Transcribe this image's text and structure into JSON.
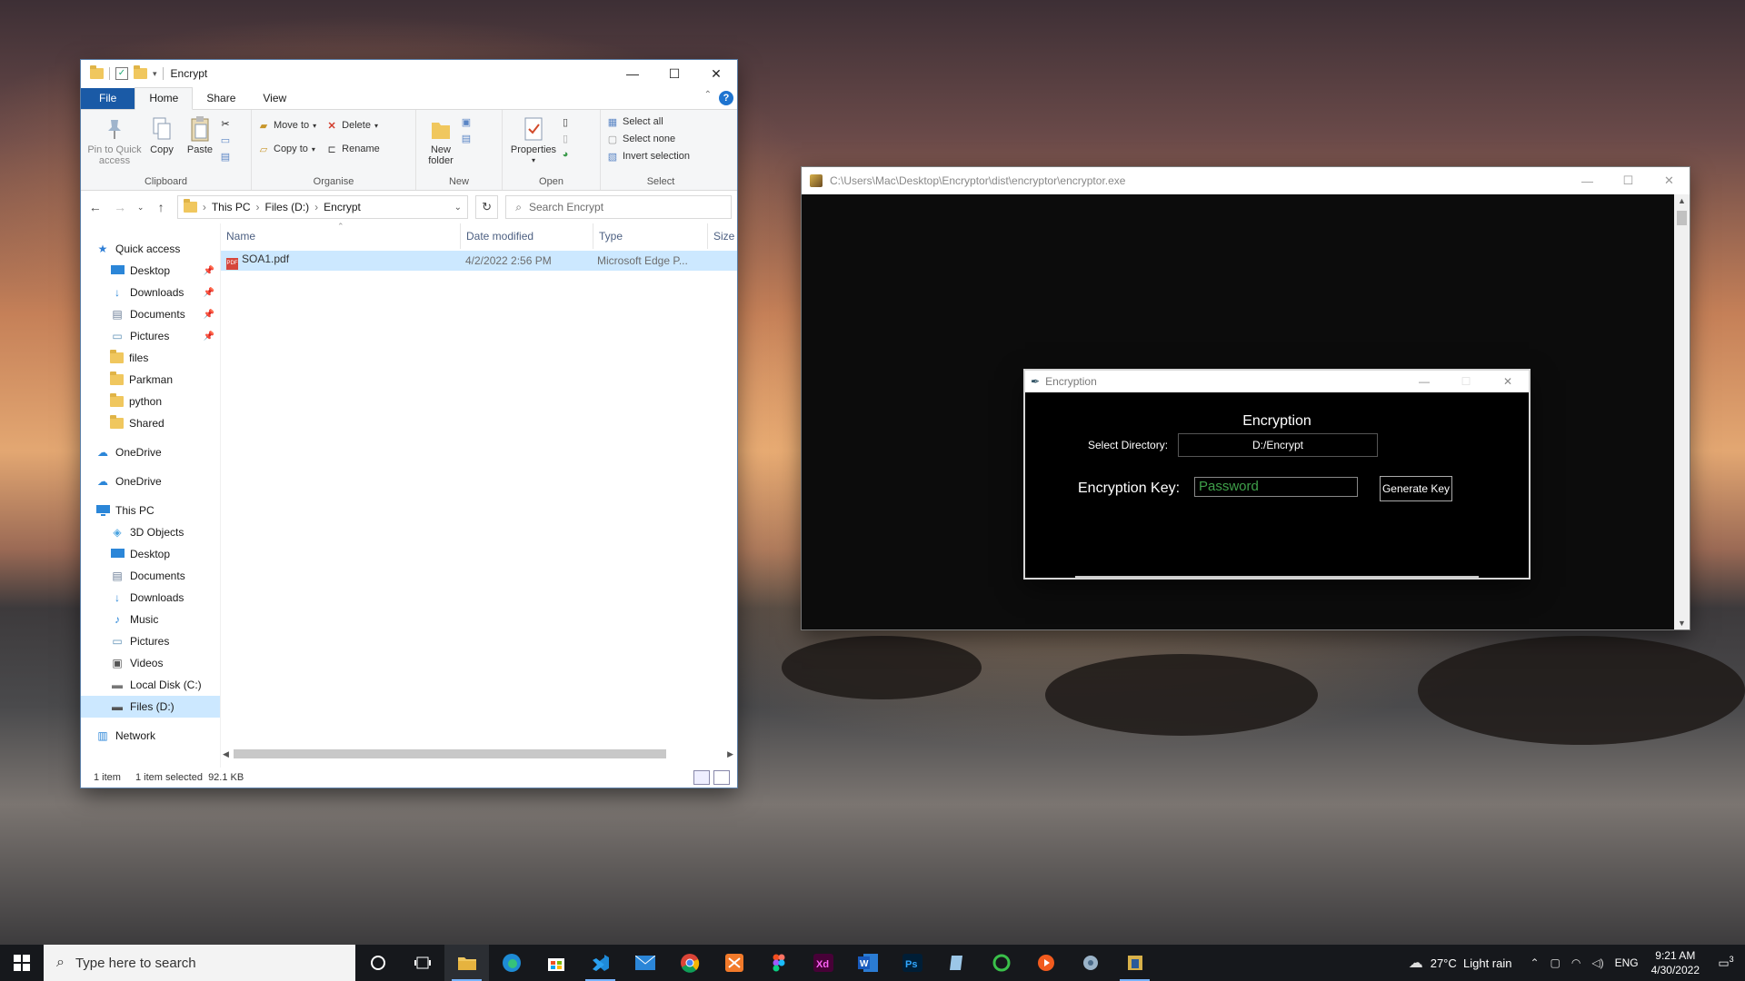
{
  "explorer": {
    "title": "Encrypt",
    "ribbon_tabs": [
      "File",
      "Home",
      "Share",
      "View"
    ],
    "clipboard": {
      "pin": "Pin to Quick access",
      "copy": "Copy",
      "paste": "Paste",
      "label": "Clipboard"
    },
    "organise": {
      "move_to": "Move to",
      "copy_to": "Copy to",
      "delete": "Delete",
      "rename": "Rename",
      "label": "Organise"
    },
    "new": {
      "new_folder": "New folder",
      "label": "New"
    },
    "open": {
      "properties": "Properties",
      "label": "Open"
    },
    "select": {
      "select_all": "Select all",
      "select_none": "Select none",
      "invert": "Invert selection",
      "label": "Select"
    },
    "breadcrumb": [
      "This PC",
      "Files (D:)",
      "Encrypt"
    ],
    "search_placeholder": "Search Encrypt",
    "nav": {
      "quick_access": "Quick access",
      "quick_items": [
        "Desktop",
        "Downloads",
        "Documents",
        "Pictures",
        "files",
        "Parkman",
        "python",
        "Shared"
      ],
      "onedrive1": "OneDrive",
      "onedrive2": "OneDrive",
      "this_pc": "This PC",
      "pc_items": [
        "3D Objects",
        "Desktop",
        "Documents",
        "Downloads",
        "Music",
        "Pictures",
        "Videos",
        "Local Disk (C:)",
        "Files (D:)"
      ],
      "network": "Network"
    },
    "columns": [
      "Name",
      "Date modified",
      "Type",
      "Size"
    ],
    "files": [
      {
        "name": "SOA1.pdf",
        "date": "4/2/2022 2:56 PM",
        "type": "Microsoft Edge P..."
      }
    ],
    "status": {
      "count": "1 item",
      "selected": "1 item selected  92.1 KB"
    }
  },
  "console": {
    "title": "C:\\Users\\Mac\\Desktop\\Encryptor\\dist\\encryptor\\encryptor.exe"
  },
  "dialog": {
    "title": "Encryption",
    "heading": "Encryption",
    "dir_label": "Select Directory:",
    "dir_value": "D:/Encrypt",
    "key_label": "Encryption Key:",
    "key_placeholder": "Password",
    "generate_button": "Generate Key"
  },
  "taskbar": {
    "search_placeholder": "Type here to search",
    "weather": "27°C  Light rain",
    "lang": "ENG",
    "time": "9:21 AM",
    "date": "4/30/2022",
    "notifications": "3"
  }
}
